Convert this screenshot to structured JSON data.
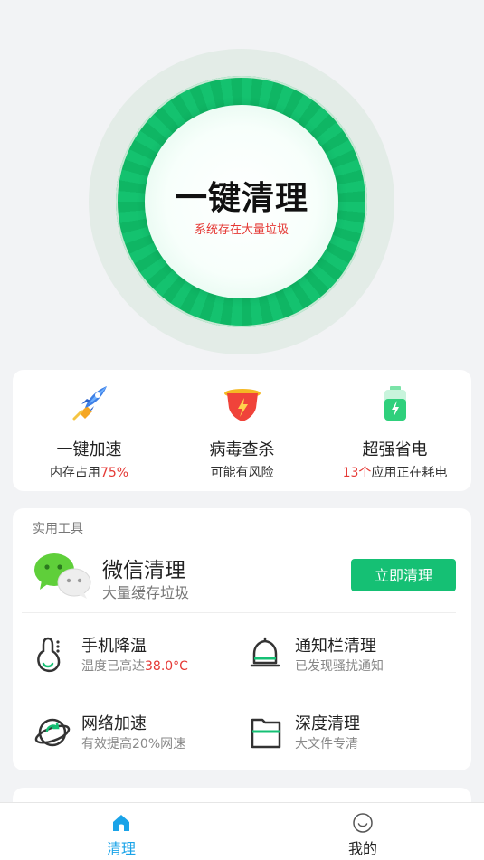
{
  "hero": {
    "title": "一键清理",
    "subtitle": "系统存在大量垃圾"
  },
  "quick_actions": [
    {
      "icon": "rocket-icon",
      "title": "一键加速",
      "sub_prefix": "内存占用",
      "sub_highlight": "75%"
    },
    {
      "icon": "virus-shield-icon",
      "title": "病毒查杀",
      "sub": "可能有风险"
    },
    {
      "icon": "battery-icon",
      "title": "超强省电",
      "sub_highlight": "13个",
      "sub_suffix": "应用正在耗电"
    }
  ],
  "tools": {
    "section_title": "实用工具",
    "wechat": {
      "title": "微信清理",
      "subtitle": "大量缓存垃圾",
      "button": "立即清理"
    },
    "items": [
      {
        "icon": "thermometer-icon",
        "title": "手机降温",
        "sub_prefix": "温度已高达",
        "sub_highlight": "38.0°C"
      },
      {
        "icon": "bell-icon",
        "title": "通知栏清理",
        "sub": "已发现骚扰通知"
      },
      {
        "icon": "network-planet-icon",
        "title": "网络加速",
        "sub": "有效提高20%网速"
      },
      {
        "icon": "folder-icon",
        "title": "深度清理",
        "sub": "大文件专清"
      }
    ]
  },
  "nav": {
    "items": [
      {
        "icon": "home-icon",
        "label": "清理",
        "active": true
      },
      {
        "icon": "smile-icon",
        "label": "我的",
        "active": false
      }
    ]
  },
  "colors": {
    "accent": "#15c074",
    "nav_active": "#1aa3e8",
    "warning_red": "#e53935",
    "warning_orange": "#f2a21b"
  }
}
